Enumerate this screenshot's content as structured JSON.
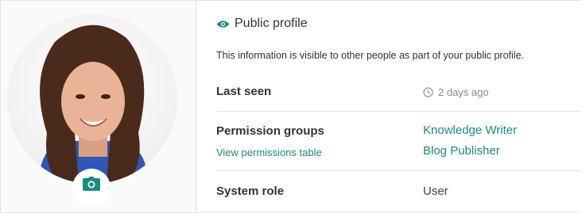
{
  "profile": {
    "header_icon": "eye-icon",
    "header_title": "Public profile",
    "description": "This information is visible to other people as part of your public profile."
  },
  "avatar": {
    "camera_icon": "camera-icon"
  },
  "fields": {
    "last_seen": {
      "label": "Last seen",
      "icon": "clock-icon",
      "value": "2 days ago"
    },
    "permission_groups": {
      "label": "Permission groups",
      "link": "View permissions table",
      "groups": [
        "Knowledge Writer",
        "Blog Publisher"
      ]
    },
    "system_role": {
      "label": "System role",
      "value": "User"
    }
  },
  "colors": {
    "accent": "#1a8c7e"
  }
}
